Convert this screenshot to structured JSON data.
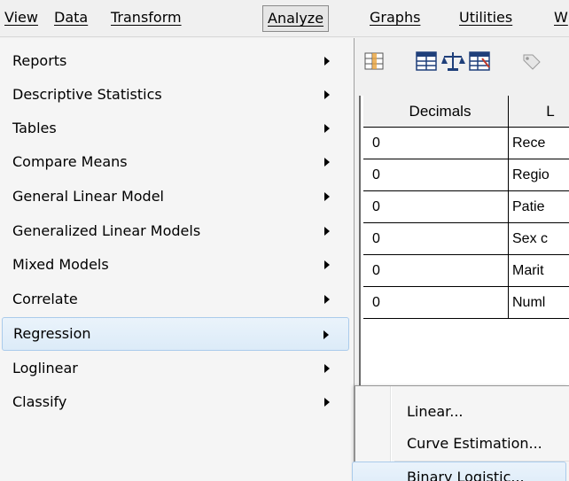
{
  "menubar": {
    "items": [
      {
        "label": "View"
      },
      {
        "label": "Data"
      },
      {
        "label": "Transform"
      },
      {
        "label": "Analyze"
      },
      {
        "label": "Graphs"
      },
      {
        "label": "Utilities"
      },
      {
        "label": "W"
      }
    ],
    "active": "Analyze"
  },
  "toolbar": {
    "icons": [
      "insert-variable-icon",
      "split-file-icon",
      "weight-cases-icon",
      "select-cases-icon",
      "value-labels-icon"
    ]
  },
  "grid": {
    "headers": {
      "decimals": "Decimals",
      "label": "L"
    },
    "rows": [
      {
        "decimals": "0",
        "label": "Rece"
      },
      {
        "decimals": "0",
        "label": "Regio"
      },
      {
        "decimals": "0",
        "label": "Patie"
      },
      {
        "decimals": "0",
        "label": "Sex c"
      },
      {
        "decimals": "0",
        "label": "Marit"
      },
      {
        "decimals": "0",
        "label": "Numl"
      }
    ]
  },
  "analyze_menu": {
    "items": [
      {
        "label": "Reports",
        "submenu": true
      },
      {
        "label": "Descriptive Statistics",
        "submenu": true
      },
      {
        "label": "Tables",
        "submenu": true
      },
      {
        "label": "Compare Means",
        "submenu": true
      },
      {
        "label": "General Linear Model",
        "submenu": true
      },
      {
        "label": "Generalized Linear Models",
        "submenu": true
      },
      {
        "label": "Mixed Models",
        "submenu": true
      },
      {
        "label": "Correlate",
        "submenu": true
      },
      {
        "label": "Regression",
        "submenu": true,
        "highlighted": true
      },
      {
        "label": "Loglinear",
        "submenu": true
      },
      {
        "label": "Classify",
        "submenu": true
      }
    ]
  },
  "regression_submenu": {
    "items": [
      {
        "label": "Linear..."
      },
      {
        "label": "Curve Estimation..."
      },
      {
        "label": "Binary Logistic...",
        "highlighted": true
      }
    ]
  },
  "colors": {
    "highlight_top": "#eaf3fb",
    "highlight_bottom": "#dcebf8",
    "highlight_border": "#aacbeb",
    "menu_bg": "#f5f5f5"
  }
}
